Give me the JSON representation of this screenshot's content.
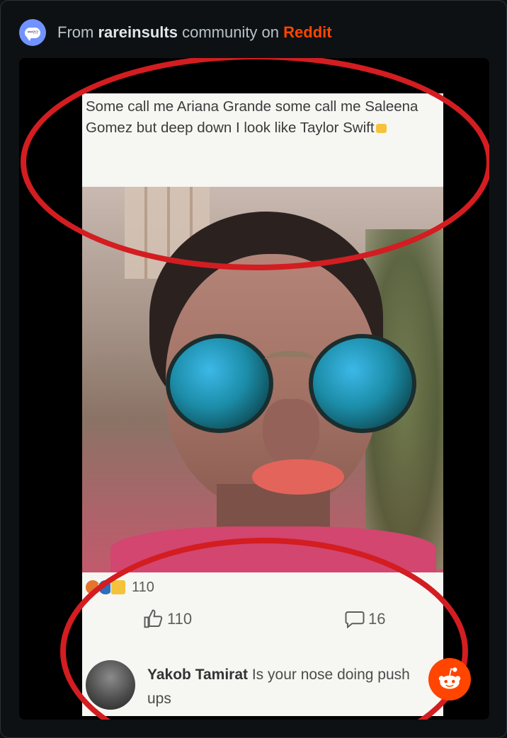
{
  "header": {
    "prefix": "From",
    "community": "rareinsults",
    "middle": "community on",
    "platform": "Reddit",
    "icon": "speech-bubble-icon",
    "icon_text": "***?!?"
  },
  "post": {
    "caption": "Some call me Ariana Grande some call me Saleena Gomez but deep down I look like Taylor Swift",
    "reaction_count": "110",
    "like_count": "110",
    "comment_count": "16",
    "comment_author": "Yakob Tamirat",
    "comment_text": "Is your nose doing push ups"
  },
  "colors": {
    "background": "#0e1113",
    "reddit_orange": "#ff4500",
    "circle_red": "#d31d21",
    "community_icon": "#7193ff"
  }
}
